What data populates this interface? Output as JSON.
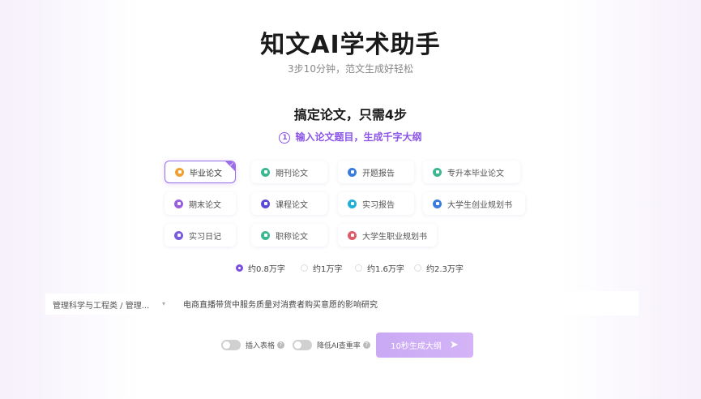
{
  "header": {
    "title": "知文AI学术助手",
    "subtitle": "3步10分钟，范文生成好轻松"
  },
  "steps": {
    "title": "搞定论文，只需4步",
    "step_number": "1",
    "step_hint": "输入论文题目，生成千字大纲"
  },
  "paper_types": [
    {
      "label": "毕业论文",
      "icon": "graduation-icon",
      "color": "#f0a030",
      "selected": true
    },
    {
      "label": "期刊论文",
      "icon": "journal-icon",
      "color": "#3cb890",
      "selected": false
    },
    {
      "label": "开题报告",
      "icon": "report-icon",
      "color": "#3a7be0",
      "selected": false
    },
    {
      "label": "专升本毕业论文",
      "icon": "upgrade-icon",
      "color": "#3cb890",
      "selected": false
    },
    {
      "label": "期末论文",
      "icon": "exam-icon",
      "color": "#9a5ee0",
      "selected": false
    },
    {
      "label": "课程论文",
      "icon": "course-icon",
      "color": "#5a4ad8",
      "selected": false
    },
    {
      "label": "实习报告",
      "icon": "internship-icon",
      "color": "#1fb0d8",
      "selected": false
    },
    {
      "label": "大学生创业规划书",
      "icon": "startup-icon",
      "color": "#3a7be0",
      "selected": false
    },
    {
      "label": "实习日记",
      "icon": "diary-icon",
      "color": "#7a5ae0",
      "selected": false
    },
    {
      "label": "职称论文",
      "icon": "title-icon",
      "color": "#3cb890",
      "selected": false
    },
    {
      "label": "大学生职业规划书",
      "icon": "career-icon",
      "color": "#e05a6a",
      "selected": false
    }
  ],
  "length_options": [
    {
      "label": "约0.8万字",
      "checked": true
    },
    {
      "label": "约1万字",
      "checked": false
    },
    {
      "label": "约1.6万字",
      "checked": false
    },
    {
      "label": "约2.3万字",
      "checked": false
    }
  ],
  "form": {
    "major_value": "管理科学与工程类 / 管理...",
    "topic_value": "电商直播带货中服务质量对消费者购买意愿的影响研究"
  },
  "options": {
    "insert_table_label": "插入表格",
    "reduce_ai_label": "降低AI查重率"
  },
  "action": {
    "generate_label": "10秒生成大纲"
  },
  "colors": {
    "accent": "#8b56e8",
    "button_bg": "#cdaef5"
  }
}
